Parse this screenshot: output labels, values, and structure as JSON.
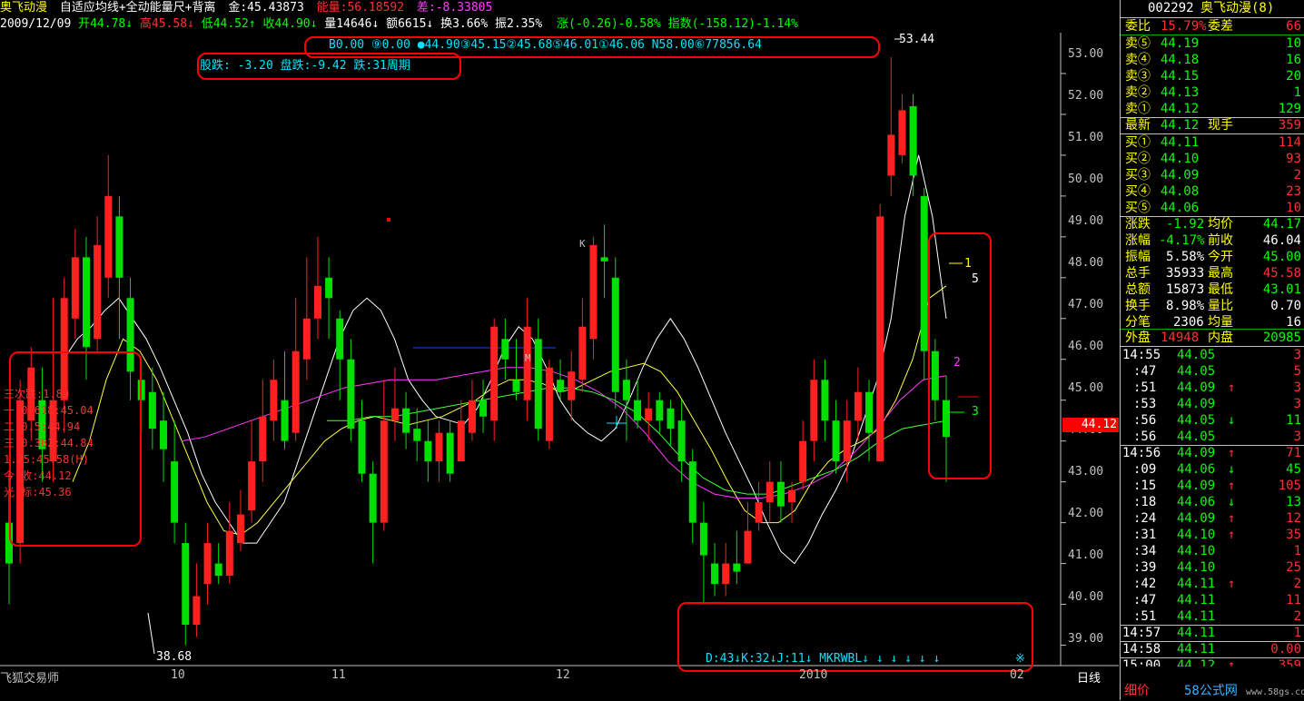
{
  "header": {
    "name": "奥飞动漫",
    "indicator": "自适应均线+全动能量尺+背离",
    "jin_label": "金:",
    "jin_value": "45.43873",
    "energy_label": "能量:",
    "energy_value": "56.18592",
    "diff_label": "差:",
    "diff_value": "-8.33805",
    "date": "2009/12/09",
    "open": "开44.78",
    "high": "高45.58",
    "low": "低44.52",
    "close": "收44.90",
    "volume": "量14646",
    "amount": "额6615",
    "turnover": "换3.66%",
    "amplitude": "振2.35%",
    "change": "涨(-0.26)-0.58%",
    "index": "指数(-158.12)-1.14%"
  },
  "annot": {
    "row1": "B0.00 ⑨0.00 ●44.90③45.15②45.68⑤46.01①46.06 N58.00⑥77856.64",
    "row2": "股跌: -3.20 盘跌:-9.42 跌:31周期",
    "peak": "53.44",
    "trough": "38.68",
    "left": [
      "三次跌:1.89",
      "一 0.618:45.04",
      "二 0.5:44.94",
      "三 0.382:44.84",
      "1.25:45.58(H)",
      "今 收:44.12",
      "光 标:45.36"
    ],
    "right_marks": [
      "1",
      "5",
      "2",
      "3"
    ],
    "kdj": "D:43↓K:32↓J:11↓ MKRWBL↓ ↓ ↓ ↓ ↓ ↓",
    "star": "※",
    "mark_m": "M",
    "mark_k": "K"
  },
  "axis": {
    "y": [
      "53.00",
      "52.00",
      "51.00",
      "50.00",
      "49.00",
      "48.00",
      "47.00",
      "46.00",
      "45.00",
      "44.00",
      "43.00",
      "42.00",
      "41.00",
      "40.00",
      "39.00"
    ],
    "current": "44.12",
    "x": [
      "10",
      "11",
      "12",
      "2010",
      "02"
    ],
    "period": "日线",
    "app": "飞狐交易师"
  },
  "panel": {
    "code": "002292",
    "name": "奥飞动漫(8)",
    "webi_label": "委比",
    "webi_value": "15.79%",
    "wecha_label": "委差",
    "wecha_value": "66",
    "asks": [
      {
        "label": "卖⑤",
        "price": "44.19",
        "qty": "10"
      },
      {
        "label": "卖④",
        "price": "44.18",
        "qty": "16"
      },
      {
        "label": "卖③",
        "price": "44.15",
        "qty": "20"
      },
      {
        "label": "卖②",
        "price": "44.13",
        "qty": "1"
      },
      {
        "label": "卖①",
        "price": "44.12",
        "qty": "129"
      }
    ],
    "latest_label": "最新",
    "latest_value": "44.12",
    "xianshou_label": "现手",
    "xianshou_value": "359",
    "bids": [
      {
        "label": "买①",
        "price": "44.11",
        "qty": "114"
      },
      {
        "label": "买②",
        "price": "44.10",
        "qty": "93"
      },
      {
        "label": "买③",
        "price": "44.09",
        "qty": "2"
      },
      {
        "label": "买④",
        "price": "44.08",
        "qty": "23"
      },
      {
        "label": "买⑤",
        "price": "44.06",
        "qty": "10"
      }
    ],
    "stats": [
      {
        "l1": "涨跌",
        "v1": "-1.92",
        "l2": "均价",
        "v2": "44.17"
      },
      {
        "l1": "涨幅",
        "v1": "-4.17%",
        "l2": "前收",
        "v2": "46.04"
      },
      {
        "l1": "振幅",
        "v1": "5.58%",
        "l2": "今开",
        "v2": "45.00"
      },
      {
        "l1": "总手",
        "v1": "35933",
        "l2": "最高",
        "v2": "45.58"
      },
      {
        "l1": "总额",
        "v1": "15873",
        "l2": "最低",
        "v2": "43.01"
      },
      {
        "l1": "换手",
        "v1": "8.98%",
        "l2": "量比",
        "v2": "0.70"
      },
      {
        "l1": "分笔",
        "v1": "2306",
        "l2": "均量",
        "v2": "16"
      }
    ],
    "waipan_label": "外盘",
    "waipan_value": "14948",
    "neipan_label": "内盘",
    "neipan_value": "20985",
    "ticks": [
      {
        "t": "14:55",
        "p": "44.05",
        "a": "",
        "v": "3"
      },
      {
        "t": ":47",
        "p": "44.05",
        "a": "",
        "v": "5"
      },
      {
        "t": ":51",
        "p": "44.09",
        "a": "↑",
        "v": "3"
      },
      {
        "t": ":53",
        "p": "44.09",
        "a": "",
        "v": "3"
      },
      {
        "t": ":56",
        "p": "44.05",
        "a": "↓",
        "v": "11"
      },
      {
        "t": ":56",
        "p": "44.05",
        "a": "",
        "v": "3"
      },
      {
        "t": "14:56",
        "p": "44.09",
        "a": "↑",
        "v": "71"
      },
      {
        "t": ":09",
        "p": "44.06",
        "a": "↓",
        "v": "45"
      },
      {
        "t": ":15",
        "p": "44.09",
        "a": "↑",
        "v": "105"
      },
      {
        "t": ":18",
        "p": "44.06",
        "a": "↓",
        "v": "13"
      },
      {
        "t": ":24",
        "p": "44.09",
        "a": "↑",
        "v": "12"
      },
      {
        "t": ":31",
        "p": "44.10",
        "a": "↑",
        "v": "35"
      },
      {
        "t": ":34",
        "p": "44.10",
        "a": "",
        "v": "1"
      },
      {
        "t": ":39",
        "p": "44.10",
        "a": "",
        "v": "25"
      },
      {
        "t": ":42",
        "p": "44.11",
        "a": "↑",
        "v": "2"
      },
      {
        "t": ":47",
        "p": "44.11",
        "a": "",
        "v": "11"
      },
      {
        "t": ":51",
        "p": "44.11",
        "a": "",
        "v": "2"
      },
      {
        "t": "14:57",
        "p": "44.11",
        "a": "",
        "v": "1"
      },
      {
        "t": "14:58",
        "p": "44.11",
        "a": "",
        "v": "0.00"
      },
      {
        "t": "15:00",
        "p": "44.12",
        "a": "↑",
        "v": "359"
      }
    ],
    "bottom_label": "细价",
    "watermark": "58公式网",
    "watermark_url": "www.58gs.com"
  },
  "chart_data": {
    "type": "candlestick",
    "ylim": [
      38.5,
      54.0
    ],
    "candles": [
      [
        42.0,
        41.0,
        43.2,
        40.0
      ],
      [
        41.5,
        45.0,
        45.5,
        41.0
      ],
      [
        44.5,
        45.8,
        46.3,
        44.0
      ],
      [
        45.0,
        43.8,
        45.8,
        43.0
      ],
      [
        43.5,
        45.0,
        47.5,
        43.0
      ],
      [
        45.0,
        47.5,
        48.0,
        44.2
      ],
      [
        47.0,
        48.5,
        49.2,
        46.5
      ],
      [
        48.5,
        46.3,
        49.0,
        45.5
      ],
      [
        46.5,
        48.8,
        49.5,
        46.2
      ],
      [
        48.0,
        50.0,
        51.0,
        47.5
      ],
      [
        49.5,
        48.0,
        50.0,
        46.5
      ],
      [
        47.5,
        45.7,
        48.0,
        45.0
      ],
      [
        45.5,
        45.0,
        46.0,
        44.2
      ],
      [
        45.2,
        44.3,
        45.8,
        43.8
      ],
      [
        44.5,
        43.8,
        45.2,
        43.0
      ],
      [
        43.5,
        42.0,
        44.5,
        41.5
      ],
      [
        41.5,
        39.5,
        42.0,
        39.0
      ],
      [
        39.5,
        40.2,
        41.0,
        39.2
      ],
      [
        40.5,
        41.5,
        42.0,
        40.0
      ],
      [
        41.0,
        40.7,
        41.5,
        40.5
      ],
      [
        40.7,
        41.8,
        42.5,
        40.5
      ],
      [
        41.5,
        42.2,
        42.8,
        41.3
      ],
      [
        42.3,
        43.5,
        44.5,
        42.0
      ],
      [
        43.5,
        44.6,
        45.5,
        43.0
      ],
      [
        44.5,
        45.5,
        46.0,
        44.0
      ],
      [
        45.0,
        44.0,
        46.2,
        43.8
      ],
      [
        44.2,
        46.2,
        47.5,
        44.0
      ],
      [
        46.0,
        47.0,
        48.5,
        45.5
      ],
      [
        47.0,
        47.8,
        49.0,
        46.5
      ],
      [
        48.0,
        47.5,
        48.5,
        46.5
      ],
      [
        47.0,
        46.0,
        47.2,
        45.0
      ],
      [
        46.0,
        44.3,
        46.5,
        44.0
      ],
      [
        44.5,
        43.2,
        45.0,
        43.0
      ],
      [
        43.2,
        42.0,
        43.5,
        41.0
      ],
      [
        42.0,
        44.5,
        45.5,
        41.8
      ],
      [
        44.5,
        44.8,
        45.8,
        44.0
      ],
      [
        44.8,
        44.2,
        45.2,
        43.8
      ],
      [
        44.3,
        44.0,
        44.8,
        43.5
      ],
      [
        44.0,
        43.5,
        44.5,
        43.0
      ],
      [
        43.5,
        44.2,
        44.5,
        43.0
      ],
      [
        44.2,
        43.2,
        44.5,
        43.0
      ],
      [
        43.5,
        44.5,
        45.0,
        43.5
      ],
      [
        44.2,
        45.0,
        45.5,
        44.0
      ],
      [
        45.0,
        44.6,
        45.5,
        44.2
      ],
      [
        44.5,
        46.8,
        47.0,
        44.0
      ],
      [
        46.5,
        46.0,
        47.0,
        45.5
      ],
      [
        45.5,
        45.2,
        46.5,
        45.0
      ],
      [
        45.0,
        46.8,
        47.5,
        44.5
      ],
      [
        46.5,
        44.3,
        47.0,
        44.0
      ],
      [
        44.0,
        45.8,
        46.0,
        43.8
      ],
      [
        45.5,
        45.2,
        46.0,
        45.0
      ],
      [
        45.0,
        45.7,
        46.2,
        44.5
      ],
      [
        45.5,
        46.8,
        47.5,
        45.2
      ],
      [
        46.5,
        48.8,
        49.0,
        46.0
      ],
      [
        48.5,
        48.4,
        49.3,
        47.5
      ],
      [
        48.0,
        45.2,
        48.5,
        44.8
      ],
      [
        45.5,
        45.0,
        46.0,
        44.0
      ],
      [
        45.0,
        44.5,
        45.5,
        44.3
      ],
      [
        44.5,
        44.8,
        45.2,
        44.0
      ],
      [
        45.0,
        44.5,
        45.2,
        44.2
      ],
      [
        44.8,
        44.3,
        45.0,
        43.9
      ],
      [
        44.5,
        43.5,
        45.0,
        43.0
      ],
      [
        43.5,
        42.0,
        43.8,
        41.5
      ],
      [
        42.0,
        41.2,
        42.5,
        40.0
      ],
      [
        41.0,
        40.5,
        41.5,
        40.2
      ],
      [
        40.5,
        41.0,
        41.5,
        40.2
      ],
      [
        41.0,
        40.8,
        41.8,
        40.5
      ],
      [
        41.0,
        41.8,
        42.5,
        41.0
      ],
      [
        42.0,
        42.5,
        43.0,
        41.8
      ],
      [
        42.5,
        43.0,
        43.5,
        42.0
      ],
      [
        43.0,
        42.4,
        43.5,
        42.0
      ],
      [
        42.5,
        42.8,
        43.0,
        42.0
      ],
      [
        43.0,
        44.0,
        44.5,
        42.8
      ],
      [
        44.0,
        45.5,
        46.0,
        43.5
      ],
      [
        45.5,
        44.5,
        46.0,
        44.0
      ],
      [
        44.5,
        43.5,
        45.0,
        43.2
      ],
      [
        43.5,
        44.5,
        45.0,
        43.0
      ],
      [
        44.5,
        45.2,
        45.8,
        44.0
      ],
      [
        45.2,
        44.2,
        45.5,
        43.5
      ],
      [
        43.5,
        49.5,
        49.8,
        43.5
      ],
      [
        50.5,
        51.5,
        53.4,
        50.0
      ],
      [
        51.0,
        52.1,
        52.5,
        50.8
      ],
      [
        52.2,
        50.5,
        52.5,
        50.0
      ],
      [
        50.0,
        46.2,
        50.2,
        45.5
      ],
      [
        46.2,
        45.0,
        46.5,
        44.5
      ],
      [
        45.0,
        44.1,
        45.6,
        43.0
      ]
    ],
    "ma_white": [
      46.0,
      46.5,
      46.8,
      47.2,
      47.5,
      47.0,
      46.5,
      45.8,
      45.0,
      44.2,
      43.2,
      42.5,
      42.0,
      41.5,
      41.5,
      42.0,
      42.5,
      43.5,
      44.5,
      45.5,
      46.5,
      47.2,
      47.5,
      47.2,
      46.5,
      45.5,
      45.0,
      44.6,
      44.5,
      44.4,
      44.8,
      45.5,
      46.3,
      46.8,
      46.5,
      45.8,
      45.0,
      44.5,
      44.2,
      44.0,
      44.3,
      45.0,
      45.8,
      46.5,
      47.0,
      46.5,
      45.8,
      45.0,
      44.2,
      43.5,
      42.8,
      42.0,
      41.3,
      41.0,
      41.5,
      42.2,
      42.8,
      43.5,
      44.5,
      45.5,
      47.0,
      49.5,
      51.0,
      49.5,
      47.0
    ],
    "ma_yellow": [
      43.0,
      44.0,
      45.5,
      46.5,
      46.2,
      45.5,
      44.5,
      43.5,
      42.5,
      41.8,
      41.7,
      42.0,
      42.5,
      43.0,
      43.5,
      44.0,
      44.3,
      44.5,
      44.6,
      44.5,
      44.4,
      44.5,
      44.6,
      44.8,
      45.0,
      45.3,
      45.5,
      45.5,
      45.4,
      45.2,
      45.3,
      45.5,
      45.7,
      45.8,
      45.9,
      45.7,
      45.2,
      44.5,
      43.8,
      43.0,
      42.3,
      42.0,
      42.0,
      42.3,
      43.0,
      43.5,
      43.8,
      44.0,
      44.3,
      45.0,
      46.0,
      47.5,
      47.8
    ],
    "ma_magenta": [
      44.0,
      44.1,
      44.3,
      44.5,
      44.7,
      44.9,
      45.1,
      45.3,
      45.4,
      45.5,
      45.5,
      45.5,
      45.6,
      45.7,
      45.8,
      45.8,
      45.7,
      45.5,
      45.2,
      44.8,
      44.2,
      43.5,
      43.0,
      42.7,
      42.6,
      42.6,
      42.7,
      42.9,
      43.2,
      43.7,
      44.3,
      45.0,
      45.5,
      45.6
    ],
    "ma_green": [
      44.5,
      44.5,
      44.6,
      44.6,
      44.7,
      44.8,
      44.9,
      45.0,
      45.1,
      45.2,
      45.3,
      45.3,
      45.2,
      45.0,
      44.7,
      44.2,
      43.6,
      43.1,
      42.8,
      42.7,
      42.7,
      42.9,
      43.1,
      43.3,
      43.6,
      44.0,
      44.3,
      44.4,
      44.5
    ]
  }
}
